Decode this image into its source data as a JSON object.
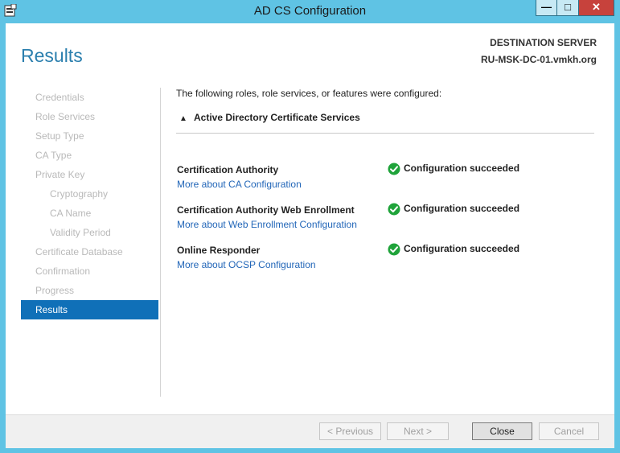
{
  "window": {
    "title": "AD CS Configuration",
    "minimize_glyph": "—",
    "maximize_glyph": "□",
    "close_glyph": "✕"
  },
  "header": {
    "page_title": "Results",
    "destination_caption": "DESTINATION SERVER",
    "destination_server": "RU-MSK-DC-01.vmkh.org"
  },
  "nav": {
    "items": [
      {
        "label": "Credentials",
        "level": 0,
        "active": false
      },
      {
        "label": "Role Services",
        "level": 0,
        "active": false
      },
      {
        "label": "Setup Type",
        "level": 0,
        "active": false
      },
      {
        "label": "CA Type",
        "level": 0,
        "active": false
      },
      {
        "label": "Private Key",
        "level": 0,
        "active": false
      },
      {
        "label": "Cryptography",
        "level": 1,
        "active": false
      },
      {
        "label": "CA Name",
        "level": 1,
        "active": false
      },
      {
        "label": "Validity Period",
        "level": 1,
        "active": false
      },
      {
        "label": "Certificate Database",
        "level": 0,
        "active": false
      },
      {
        "label": "Confirmation",
        "level": 0,
        "active": false
      },
      {
        "label": "Progress",
        "level": 0,
        "active": false
      },
      {
        "label": "Results",
        "level": 0,
        "active": true
      }
    ]
  },
  "content": {
    "intro": "The following roles, role services, or features were configured:",
    "section_title": "Active Directory Certificate Services",
    "section_chevron": "▲",
    "results": [
      {
        "name": "Certification Authority",
        "link": "More about CA Configuration",
        "status": "Configuration succeeded"
      },
      {
        "name": "Certification Authority Web Enrollment",
        "link": "More about Web Enrollment Configuration",
        "status": "Configuration succeeded"
      },
      {
        "name": "Online Responder",
        "link": "More about OCSP Configuration",
        "status": "Configuration succeeded"
      }
    ]
  },
  "footer": {
    "previous_label": "< Previous",
    "next_label": "Next >",
    "close_label": "Close",
    "cancel_label": "Cancel"
  },
  "colors": {
    "frame": "#5fc3e4",
    "accent": "#1070b8",
    "link": "#2266b8",
    "success": "#1fa33a",
    "close_button": "#c7423c"
  },
  "icons": {
    "app": "server-manager-icon",
    "status": "check-circle-icon"
  }
}
